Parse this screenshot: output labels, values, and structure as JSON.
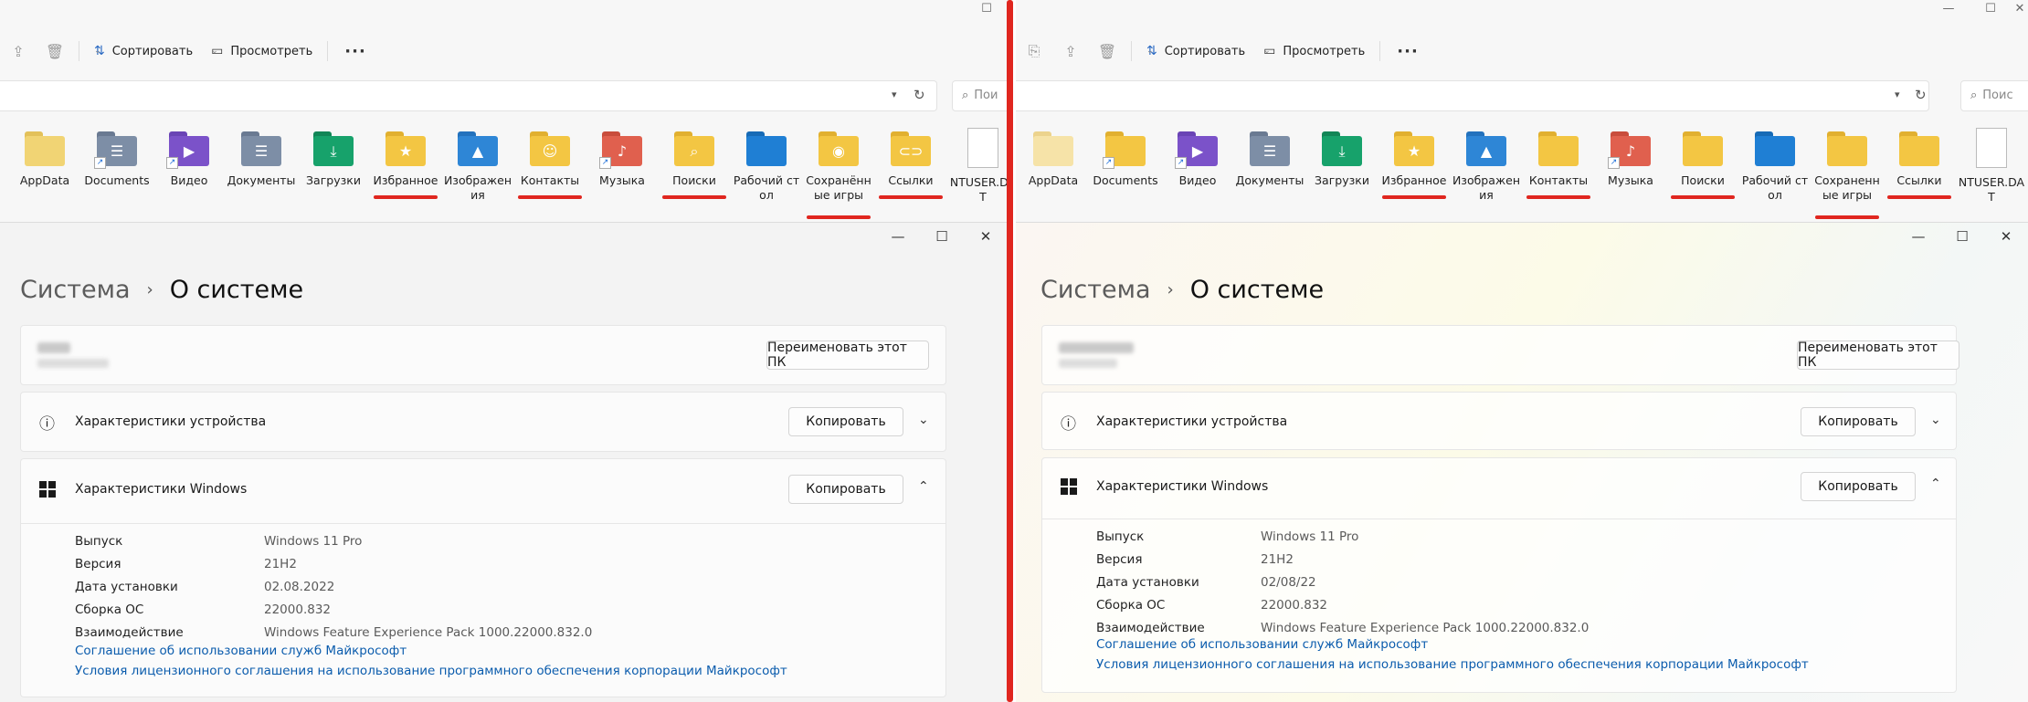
{
  "explorer": {
    "toolbar": {
      "sort_label": "Сортировать",
      "view_label": "Просмотреть",
      "more_label": "···"
    },
    "window_controls": {
      "minimize": "—",
      "maximize": "☐",
      "close": "✕"
    },
    "left_search": "Пои",
    "right_search": "Поис",
    "left_folders": [
      {
        "label": "AppData"
      },
      {
        "label": "Documents"
      },
      {
        "label": "Видео"
      },
      {
        "label": "Документы"
      },
      {
        "label": "Загрузки"
      },
      {
        "label": "Избранное"
      },
      {
        "label": "Изображения"
      },
      {
        "label": "Контакты"
      },
      {
        "label": "Музыка"
      },
      {
        "label": "Поиски"
      },
      {
        "label": "Рабочий стол"
      },
      {
        "label": "Сохранённые игры"
      },
      {
        "label": "Ссылки"
      },
      {
        "label": "NTUSER.DAT"
      }
    ],
    "right_folders": [
      {
        "label": "AppData"
      },
      {
        "label": "Documents"
      },
      {
        "label": "Видео"
      },
      {
        "label": "Документы"
      },
      {
        "label": "Загрузки"
      },
      {
        "label": "Избранное"
      },
      {
        "label": "Изображения"
      },
      {
        "label": "Контакты"
      },
      {
        "label": "Музыка"
      },
      {
        "label": "Поиски"
      },
      {
        "label": "Рабочий стол"
      },
      {
        "label": "Сохраненные игры"
      },
      {
        "label": "Ссылки"
      },
      {
        "label": "NTUSER.DAT"
      }
    ]
  },
  "settings": {
    "breadcrumb_parent": "Система",
    "breadcrumb_current": "О системе",
    "rename_button": "Переименовать этот ПК",
    "device_specs_title": "Характеристики устройства",
    "windows_specs_title": "Характеристики Windows",
    "copy_button": "Копировать",
    "spec_labels": [
      "Выпуск",
      "Версия",
      "Дата установки",
      "Сборка ОС",
      "Взаимодействие"
    ],
    "left_values": [
      "Windows 11 Pro",
      "21H2",
      "02.08.2022",
      "22000.832",
      "Windows Feature Experience Pack 1000.22000.832.0"
    ],
    "right_values": [
      "Windows 11 Pro",
      "21H2",
      "02/08/22",
      "22000.832",
      "Windows Feature Experience Pack 1000.22000.832.0"
    ],
    "link_services": "Соглашение об использовании служб Майкрософт",
    "link_license": "Условия лицензионного соглашения на использование программного обеспечения корпорации Майкрософт"
  },
  "colors": {
    "annotation_red": "#e0261f",
    "folder_yellow": "#f3c643",
    "link_blue": "#0b5cad"
  }
}
